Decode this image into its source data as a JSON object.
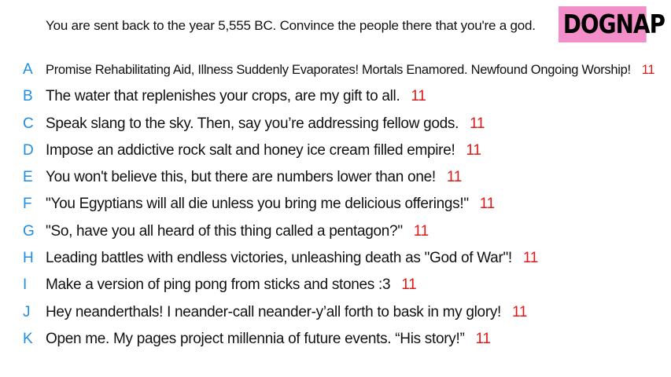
{
  "prompt": "You are sent back to the year 5,555 BC. Convince the people there that you're a god.",
  "logo_text": "DOGNAP",
  "colors": {
    "letter": "#1f8de0",
    "score": "#e01818",
    "logo_bg": "#f28ec8"
  },
  "answers": [
    {
      "letter": "A",
      "text": "Promise Rehabilitating Aid, Illness Suddenly Evaporates! Mortals Enamored. Newfound Ongoing Worship!",
      "score": "11"
    },
    {
      "letter": "B",
      "text": "The water that replenishes your crops, are my gift to all.",
      "score": "11"
    },
    {
      "letter": "C",
      "text": "Speak slang to the sky. Then, say you’re addressing fellow gods.",
      "score": "11"
    },
    {
      "letter": "D",
      "text": "Impose an addictive rock salt and honey ice cream filled empire!",
      "score": "11"
    },
    {
      "letter": "E",
      "text": "You won't believe this, but there are numbers lower than one!",
      "score": "11"
    },
    {
      "letter": "F",
      "text": "\"You Egyptians will all die unless you bring me delicious offerings!\"",
      "score": "11"
    },
    {
      "letter": "G",
      "text": "\"So, have you all heard of this thing called a pentagon?\"",
      "score": "11"
    },
    {
      "letter": "H",
      "text": "Leading battles with endless victories, unleashing death as \"God of War\"!",
      "score": "11"
    },
    {
      "letter": "I",
      "text": "Make a version of ping pong from sticks and stones :3",
      "score": "11"
    },
    {
      "letter": "J",
      "text": "Hey neanderthals! I neander-call neander-y’all forth to bask in my glory!",
      "score": "11"
    },
    {
      "letter": "K",
      "text": "Open me. My pages project millennia of future events. “His story!”",
      "score": "11"
    }
  ]
}
